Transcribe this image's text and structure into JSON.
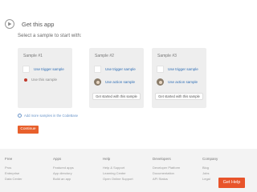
{
  "page": {
    "title": "Get this app",
    "subtitle": "Select a sample to start with:"
  },
  "cards": [
    {
      "title": "Sample #1",
      "options": [
        {
          "label": "Use trigger sample",
          "kind": "box",
          "muted": false
        },
        {
          "label": "Use this sample",
          "kind": "dot",
          "muted": true
        }
      ],
      "button": null
    },
    {
      "title": "Sample #2",
      "options": [
        {
          "label": "Use trigger sample",
          "kind": "box",
          "muted": false
        },
        {
          "label": "Use action sample",
          "kind": "avatar",
          "muted": false
        }
      ],
      "button": "Get started with this sample"
    },
    {
      "title": "Sample #3",
      "options": [
        {
          "label": "Use trigger sample",
          "kind": "box",
          "muted": false
        },
        {
          "label": "Use action sample",
          "kind": "avatar",
          "muted": false
        }
      ],
      "button": "Get started with this sample"
    }
  ],
  "more_link": "Add more samples in the CodeBase",
  "continue_label": "Continue",
  "footer": {
    "columns": [
      {
        "heading": "Free",
        "items": [
          "Pros",
          "Enterprise",
          "Data Center"
        ]
      },
      {
        "heading": "Apps",
        "items": [
          "Featured apps",
          "App directory",
          "Build an app"
        ]
      },
      {
        "heading": "Help",
        "items": [
          "Help & Support",
          "Learning Center",
          "Open Online Support"
        ]
      },
      {
        "heading": "Developers",
        "items": [
          "Developer Platform",
          "Documentation",
          "API Status"
        ]
      },
      {
        "heading": "Company",
        "items": [
          "Blog",
          "Jobs",
          "Legal"
        ]
      }
    ]
  },
  "help_button": "Get Help",
  "colors": {
    "accent": "#e8602c",
    "link": "#2d6db5"
  }
}
